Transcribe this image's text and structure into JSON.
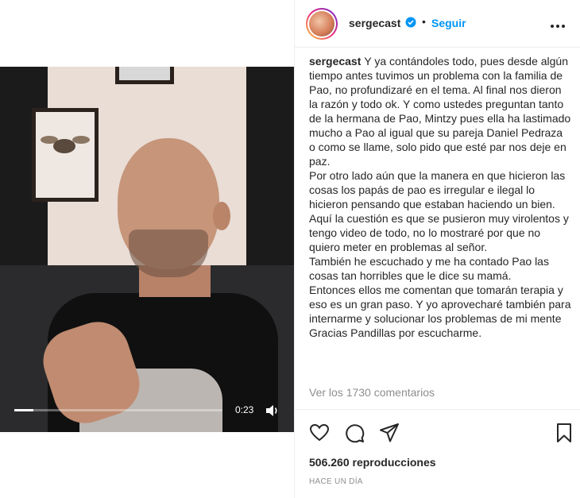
{
  "post": {
    "username": "sergecast",
    "follow_label": "Seguir",
    "separator": "•",
    "caption": "Y ya contándoles todo, pues desde algún tiempo antes tuvimos un problema con la familia de Pao, no profundizaré en el tema. Al final nos dieron la razón y todo ok. Y como ustedes preguntan tanto de la hermana de Pao, Mintzy pues ella ha lastimado mucho a Pao al igual que su pareja Daniel Pedraza o como se llame, solo pido que esté par nos deje en paz.\nPor otro lado aún que la manera en que hicieron las cosas los papás de pao es irregular e ilegal lo hicieron pensando que estaban haciendo un bien. Aquí la cuestión es que se pusieron muy virolentos y tengo video de todo, no lo mostraré por que no quiero meter en problemas al señor.\nTambién he escuchado y me ha contado Pao las cosas tan horribles que le dice su mamá.\nEntonces ellos me comentan que tomarán terapia y eso es un gran paso. Y yo aprovecharé también para internarme y solucionar los problemas de mi mente\nGracias Pandillas por escucharme.",
    "comments_link": "Ver los 1730 comentarios",
    "views": "506.260 reproducciones",
    "date": "HACE UN DÍA"
  },
  "video": {
    "time": "0:23",
    "progress_fraction": 0.09
  },
  "icons": {
    "verified": "verified-badge-icon",
    "more": "more-options-icon",
    "like": "heart-icon",
    "comment": "comment-icon",
    "share": "share-icon",
    "save": "bookmark-icon",
    "volume": "volume-icon"
  },
  "colors": {
    "link": "#0095f6",
    "text": "#262626",
    "muted": "#8e8e8e"
  }
}
